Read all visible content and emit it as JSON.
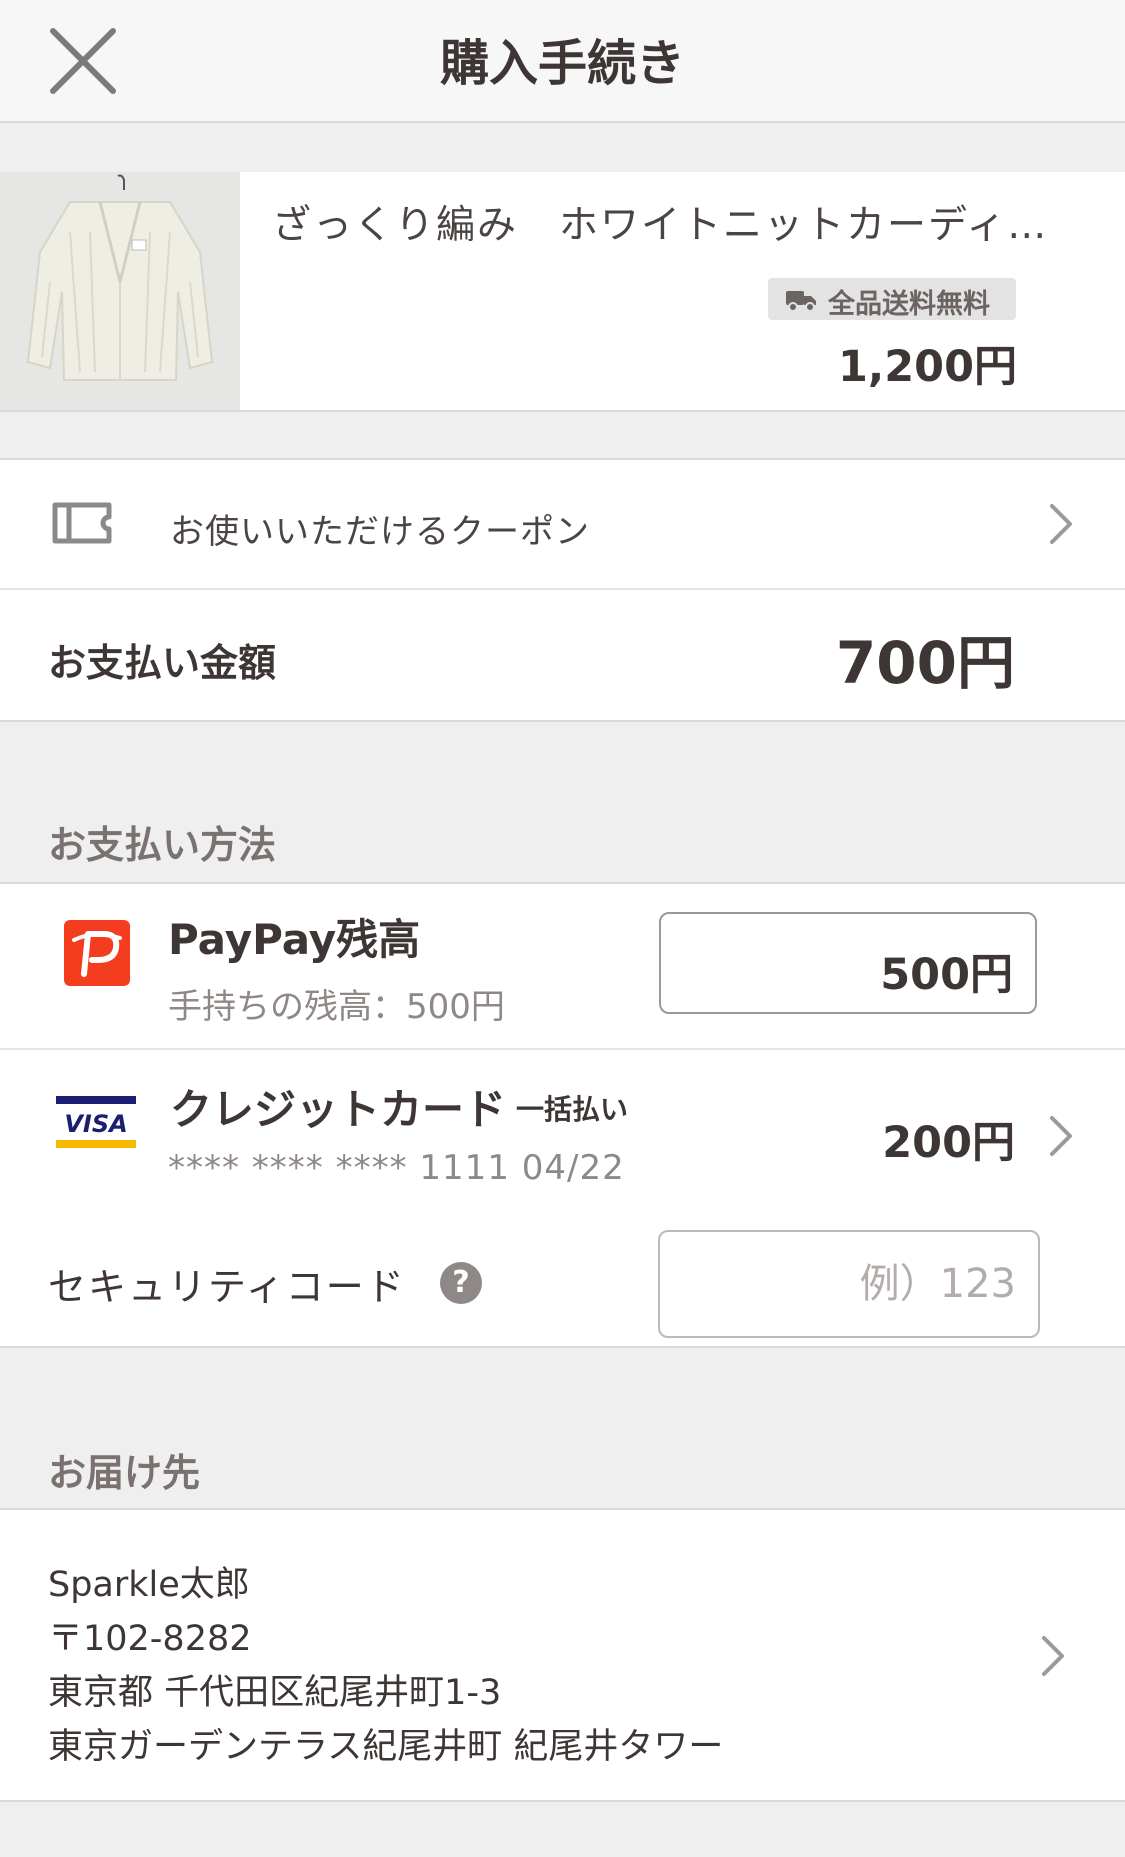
{
  "header": {
    "title": "購入手続き",
    "close_icon": "close-icon"
  },
  "product": {
    "name": "ざっくり編み　ホワイトニットカーディ…",
    "shipping_badge": "全品送料無料",
    "price": "1,200円",
    "image": "white-knit-cardigan-photo"
  },
  "coupon": {
    "label": "お使いいただけるクーポン",
    "icon": "ticket-icon"
  },
  "total": {
    "label": "お支払い金額",
    "amount": "700円"
  },
  "payment": {
    "section_title": "お支払い方法",
    "paypay": {
      "title": "PayPay残高",
      "balance": "手持ちの残高：500円",
      "amount": "500円",
      "icon": "paypay-icon",
      "brand_color": "#f43d1f"
    },
    "card": {
      "title": "クレジットカード",
      "method": "一括払い",
      "number": "**** **** **** 1111 04/22",
      "amount": "200円",
      "brand": "VISA"
    },
    "security": {
      "label": "セキュリティコード",
      "help": "?",
      "placeholder": "例）123"
    }
  },
  "address": {
    "section_title": "お届け先",
    "name": "Sparkle太郎",
    "postal": "〒102-8282",
    "line1": "東京都 千代田区紀尾井町1-3",
    "line2": "東京ガーデンテラス紀尾井町 紀尾井タワー"
  }
}
